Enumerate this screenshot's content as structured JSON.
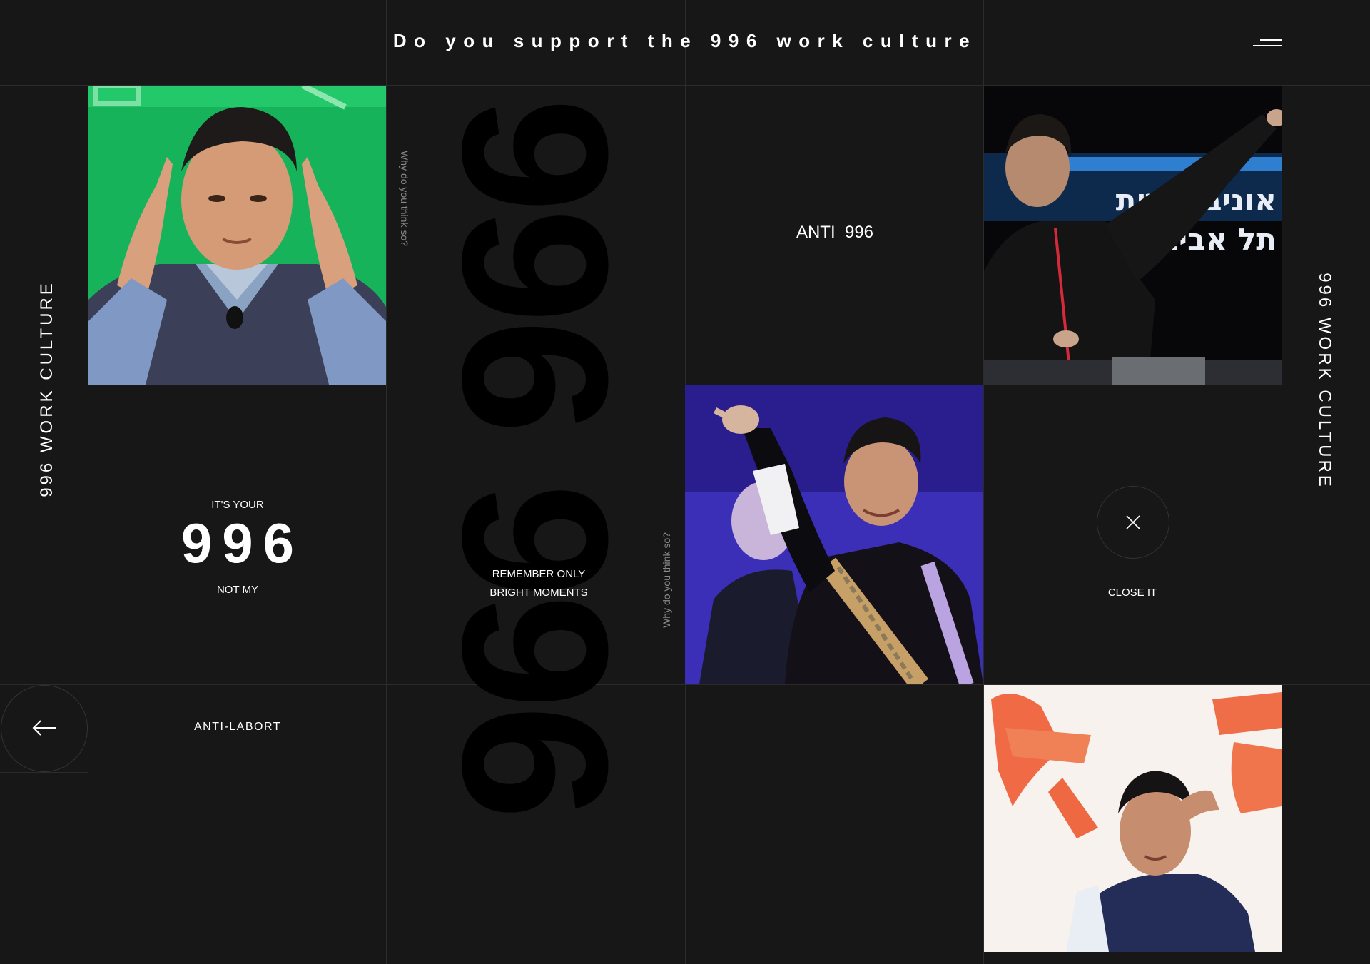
{
  "header": {
    "title": "Do you support the 996 work culture"
  },
  "side": {
    "left_text": "996 WORK CULTURE",
    "right_text": "996 WORK CULTURE"
  },
  "background": {
    "big_number": "996 996"
  },
  "prompts": {
    "why_top": "Why do you think so?",
    "why_bottom": "Why do you think so?"
  },
  "tiles": {
    "anti996": "ANTI  996",
    "its_your": "IT'S YOUR",
    "number": "996",
    "not_my": "NOT MY",
    "remember_line1": "REMEMBER ONLY",
    "remember_line2": "BRIGHT MOMENTS",
    "close_label": "CLOSE IT",
    "anti_labort": "ANTI-LABORT"
  },
  "photos": {
    "hebrew_sign_line1": "אוניברסיטת",
    "hebrew_sign_line2": "תל אביב"
  },
  "colors": {
    "background": "#171717",
    "grid_line": "#2b2b2b",
    "text": "#ffffff",
    "muted": "#8a8a8a"
  },
  "icons": {
    "menu": "menu-icon",
    "close": "close-icon",
    "back": "arrow-left-icon"
  }
}
